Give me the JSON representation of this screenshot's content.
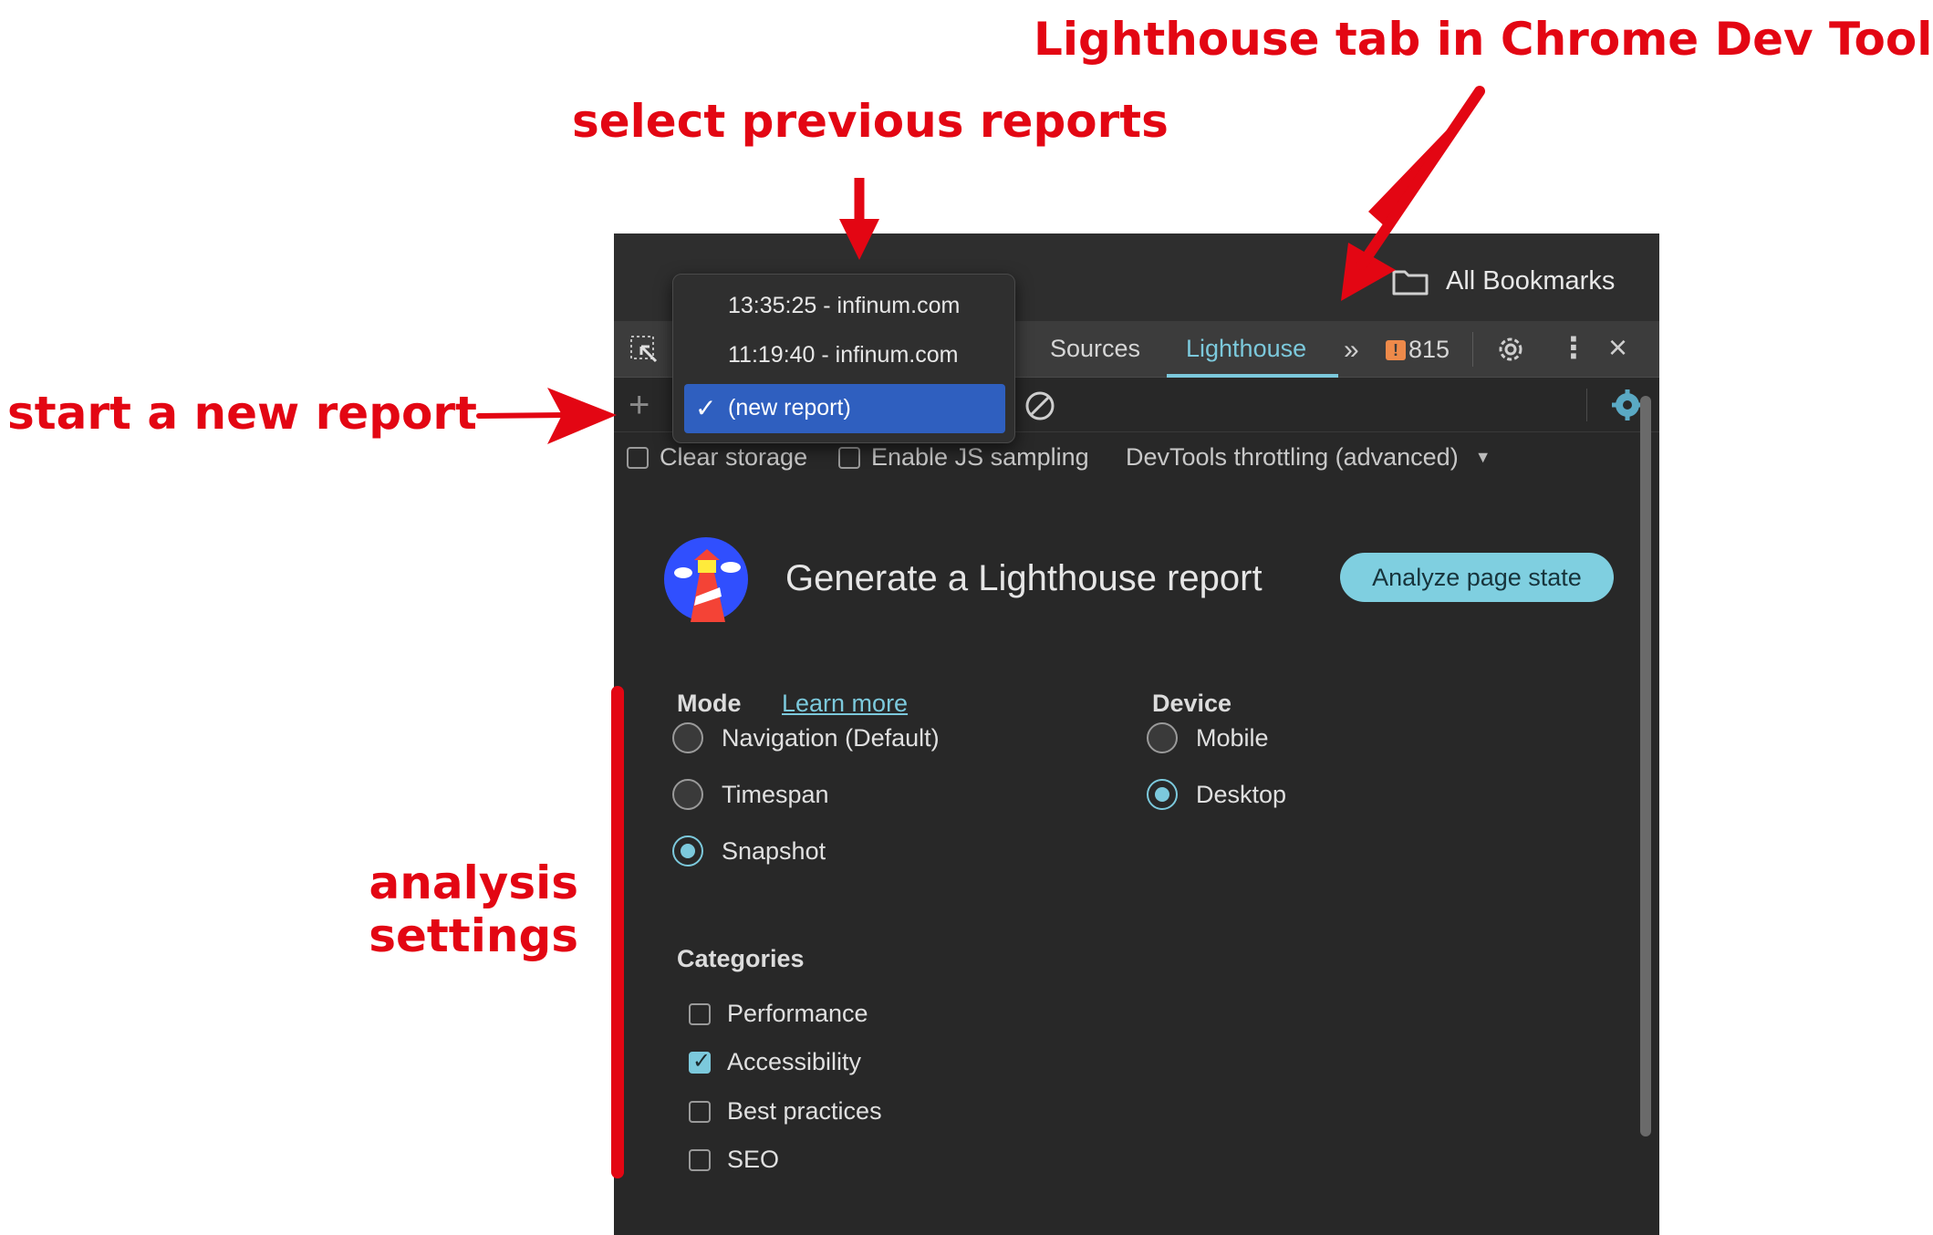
{
  "annotations": {
    "lighthouse_tab": "Lighthouse tab in Chrome Dev Tools",
    "select_previous": "select previous reports",
    "start_new": "start a new report",
    "analysis_settings_line1": "analysis",
    "analysis_settings_line2": "settings"
  },
  "colors": {
    "annotation": "#e30613",
    "accent": "#7cc9dc",
    "selected": "#2f5fbf"
  },
  "bookmarks": {
    "label": "All Bookmarks",
    "icon": "folder-icon"
  },
  "tabs": {
    "sources": "Sources",
    "lighthouse": "Lighthouse",
    "issues_count": "815",
    "issues_icon": "!"
  },
  "report_dropdown": {
    "items": [
      "13:35:25 - infinum.com",
      "11:19:40 - infinum.com"
    ],
    "selected": "(new report)"
  },
  "options": {
    "clear_storage": "Clear storage",
    "enable_js_sampling": "Enable JS sampling",
    "throttling": "DevTools throttling (advanced)"
  },
  "main": {
    "title": "Generate a Lighthouse report",
    "analyze_button": "Analyze page state"
  },
  "mode": {
    "label": "Mode",
    "learn_more": "Learn more",
    "options": [
      "Navigation (Default)",
      "Timespan",
      "Snapshot"
    ],
    "selected": "Snapshot"
  },
  "device": {
    "label": "Device",
    "options": [
      "Mobile",
      "Desktop"
    ],
    "selected": "Desktop"
  },
  "categories": {
    "label": "Categories",
    "items": [
      "Performance",
      "Accessibility",
      "Best practices",
      "SEO"
    ],
    "checked": [
      "Accessibility"
    ]
  }
}
